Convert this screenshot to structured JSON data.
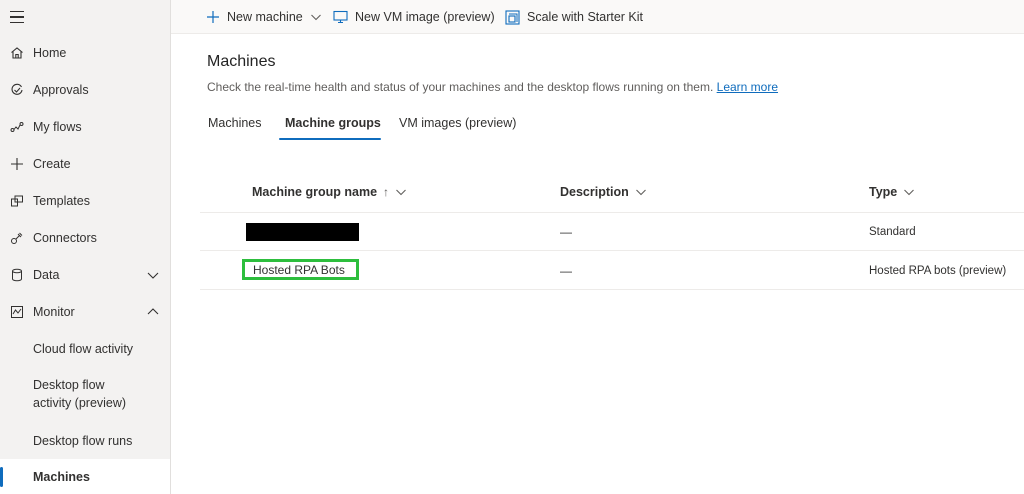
{
  "sidebar": {
    "items": [
      {
        "label": "Home",
        "icon": "home-icon"
      },
      {
        "label": "Approvals",
        "icon": "approvals-icon"
      },
      {
        "label": "My flows",
        "icon": "flows-icon"
      },
      {
        "label": "Create",
        "icon": "plus-icon"
      },
      {
        "label": "Templates",
        "icon": "templates-icon"
      },
      {
        "label": "Connectors",
        "icon": "connectors-icon"
      },
      {
        "label": "Data",
        "icon": "database-icon",
        "expandable": true,
        "expanded": false
      },
      {
        "label": "Monitor",
        "icon": "monitor-icon",
        "expandable": true,
        "expanded": true
      }
    ],
    "monitor_sub": [
      {
        "label": "Cloud flow activity"
      },
      {
        "label": "Desktop flow activity (preview)",
        "line1": "Desktop flow",
        "line2": "activity (preview)"
      },
      {
        "label": "Desktop flow runs"
      },
      {
        "label": "Machines",
        "active": true
      }
    ],
    "accent_color": "#0f6cbd"
  },
  "toolbar": {
    "new_machine": "New machine",
    "new_vm_image": "New VM image (preview)",
    "scale_starter_kit": "Scale with Starter Kit"
  },
  "main": {
    "title": "Machines",
    "description": "Check the real-time health and status of your machines and the desktop flows running on them.",
    "learn_more": "Learn more",
    "tabs": [
      {
        "label": "Machines",
        "active": false
      },
      {
        "label": "Machine groups",
        "active": true
      },
      {
        "label": "VM images (preview)",
        "active": false
      }
    ],
    "table": {
      "columns": {
        "name": "Machine group name",
        "name_sort_indicator": "↑",
        "description": "Description",
        "type": "Type"
      },
      "rows": [
        {
          "name": "",
          "redacted": true,
          "description": "—",
          "type": "Standard"
        },
        {
          "name": "Hosted RPA Bots",
          "highlighted": true,
          "description": "—",
          "type": "Hosted RPA bots (preview)"
        }
      ],
      "highlight_color": "#2dbe3d"
    }
  }
}
